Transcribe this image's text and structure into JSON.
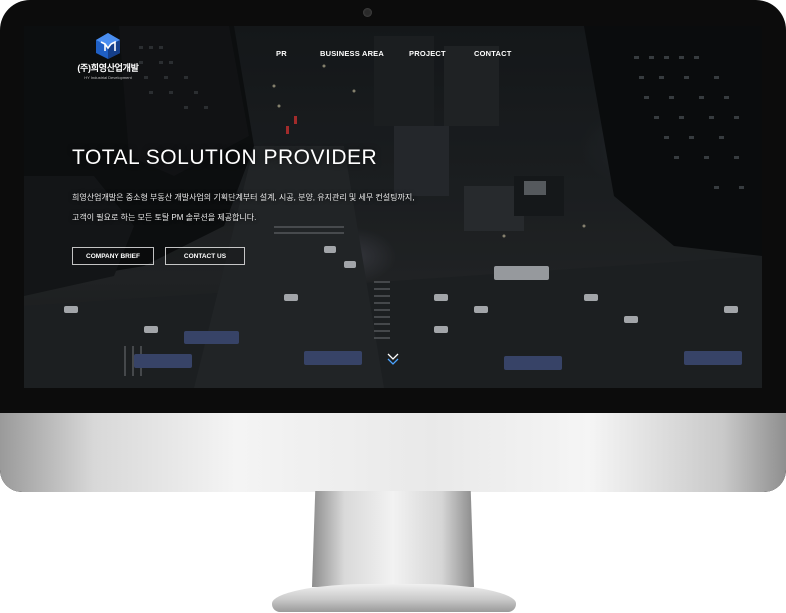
{
  "brand": {
    "name": "(주)희영산업개발",
    "sub": "HY Industrial Development",
    "accent": "#2a6fd6"
  },
  "nav": {
    "items": [
      {
        "label": "PR"
      },
      {
        "label": "BUSINESS AREA"
      },
      {
        "label": "PROJECT"
      },
      {
        "label": "CONTACT"
      }
    ]
  },
  "hero": {
    "title": "TOTAL SOLUTION PROVIDER",
    "desc_line1": "희영산업개발은 중소형 부동산 개발사업의 기획단계부터 설계, 시공, 분양, 유지관리 및 세무 컨설팅까지,",
    "desc_line2": "고객이 필요로 하는 모든 토탈 PM 솔루션을 제공합니다.",
    "buttons": {
      "brief": "COMPANY BRIEF",
      "contact": "CONTACT US"
    }
  },
  "icons": {
    "scroll": "chevron-double-down-icon",
    "logo": "cube-logo-icon"
  },
  "colors": {
    "screen_bg": "#1e2124",
    "text": "#ffffff",
    "monitor_bezel": "#0c0c0c",
    "monitor_chin": "#e5e5e5"
  }
}
